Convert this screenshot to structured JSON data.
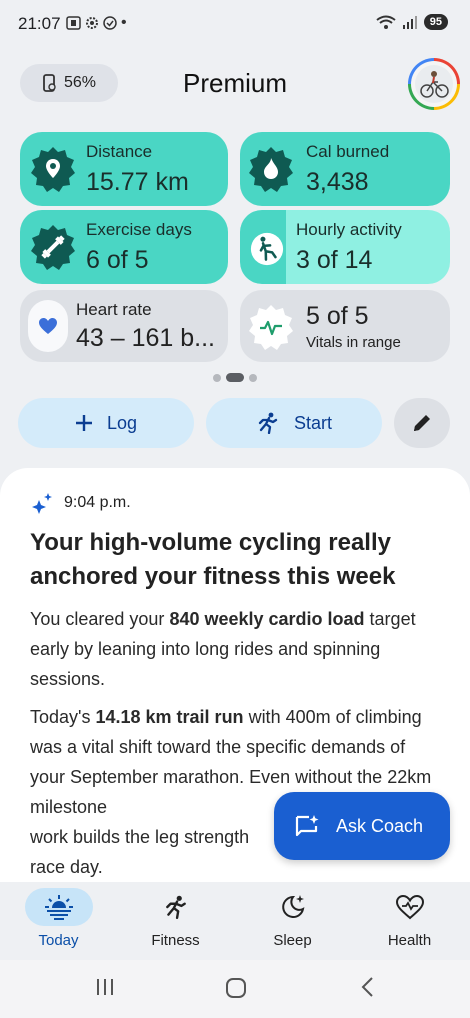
{
  "status_bar": {
    "time": "21:07",
    "left_icons": [
      "screenshot-icon",
      "gear-icon",
      "shield-icon",
      "dot"
    ],
    "battery": "95"
  },
  "header": {
    "device_battery": "56%",
    "title": "Premium"
  },
  "tiles": {
    "distance": {
      "label": "Distance",
      "value": "15.77 km"
    },
    "calories": {
      "label": "Cal burned",
      "value": "3,438"
    },
    "exercise_days": {
      "label": "Exercise days",
      "value": "6 of 5"
    },
    "hourly_activity": {
      "label": "Hourly activity",
      "value": "3 of 14"
    },
    "heart_rate": {
      "label": "Heart rate",
      "value": "43 – 161 b..."
    },
    "vitals": {
      "value": "5 of 5",
      "label": "Vitals in range"
    }
  },
  "actions": {
    "log": "Log",
    "start": "Start"
  },
  "insight": {
    "time": "9:04 p.m.",
    "headline": "Your high-volume cycling really anchored your fitness this week",
    "para1_pre": "You cleared your ",
    "para1_bold": "840 weekly cardio load",
    "para1_post": " target early by leaning into long rides and spinning sessions.",
    "para2_pre": "Today's ",
    "para2_bold": "14.18 km trail run",
    "para2_post": " with 400m of climbing was a vital shift toward the specific demands of your September marathon. Even without the 22km milestone",
    "para2_line5": "work builds the leg strength",
    "para2_line6": "race day."
  },
  "fab": {
    "label": "Ask Coach"
  },
  "bottom_nav": [
    {
      "label": "Today",
      "icon": "sunrise-icon",
      "active": true
    },
    {
      "label": "Fitness",
      "icon": "running-icon",
      "active": false
    },
    {
      "label": "Sleep",
      "icon": "moon-icon",
      "active": false
    },
    {
      "label": "Health",
      "icon": "heart-pulse-icon",
      "active": false
    }
  ],
  "colors": {
    "teal": "#4ad6c4",
    "light_teal": "#8ff0e2",
    "accent_blue": "#1a5fd1",
    "pill_blue": "#d4ebfa"
  }
}
